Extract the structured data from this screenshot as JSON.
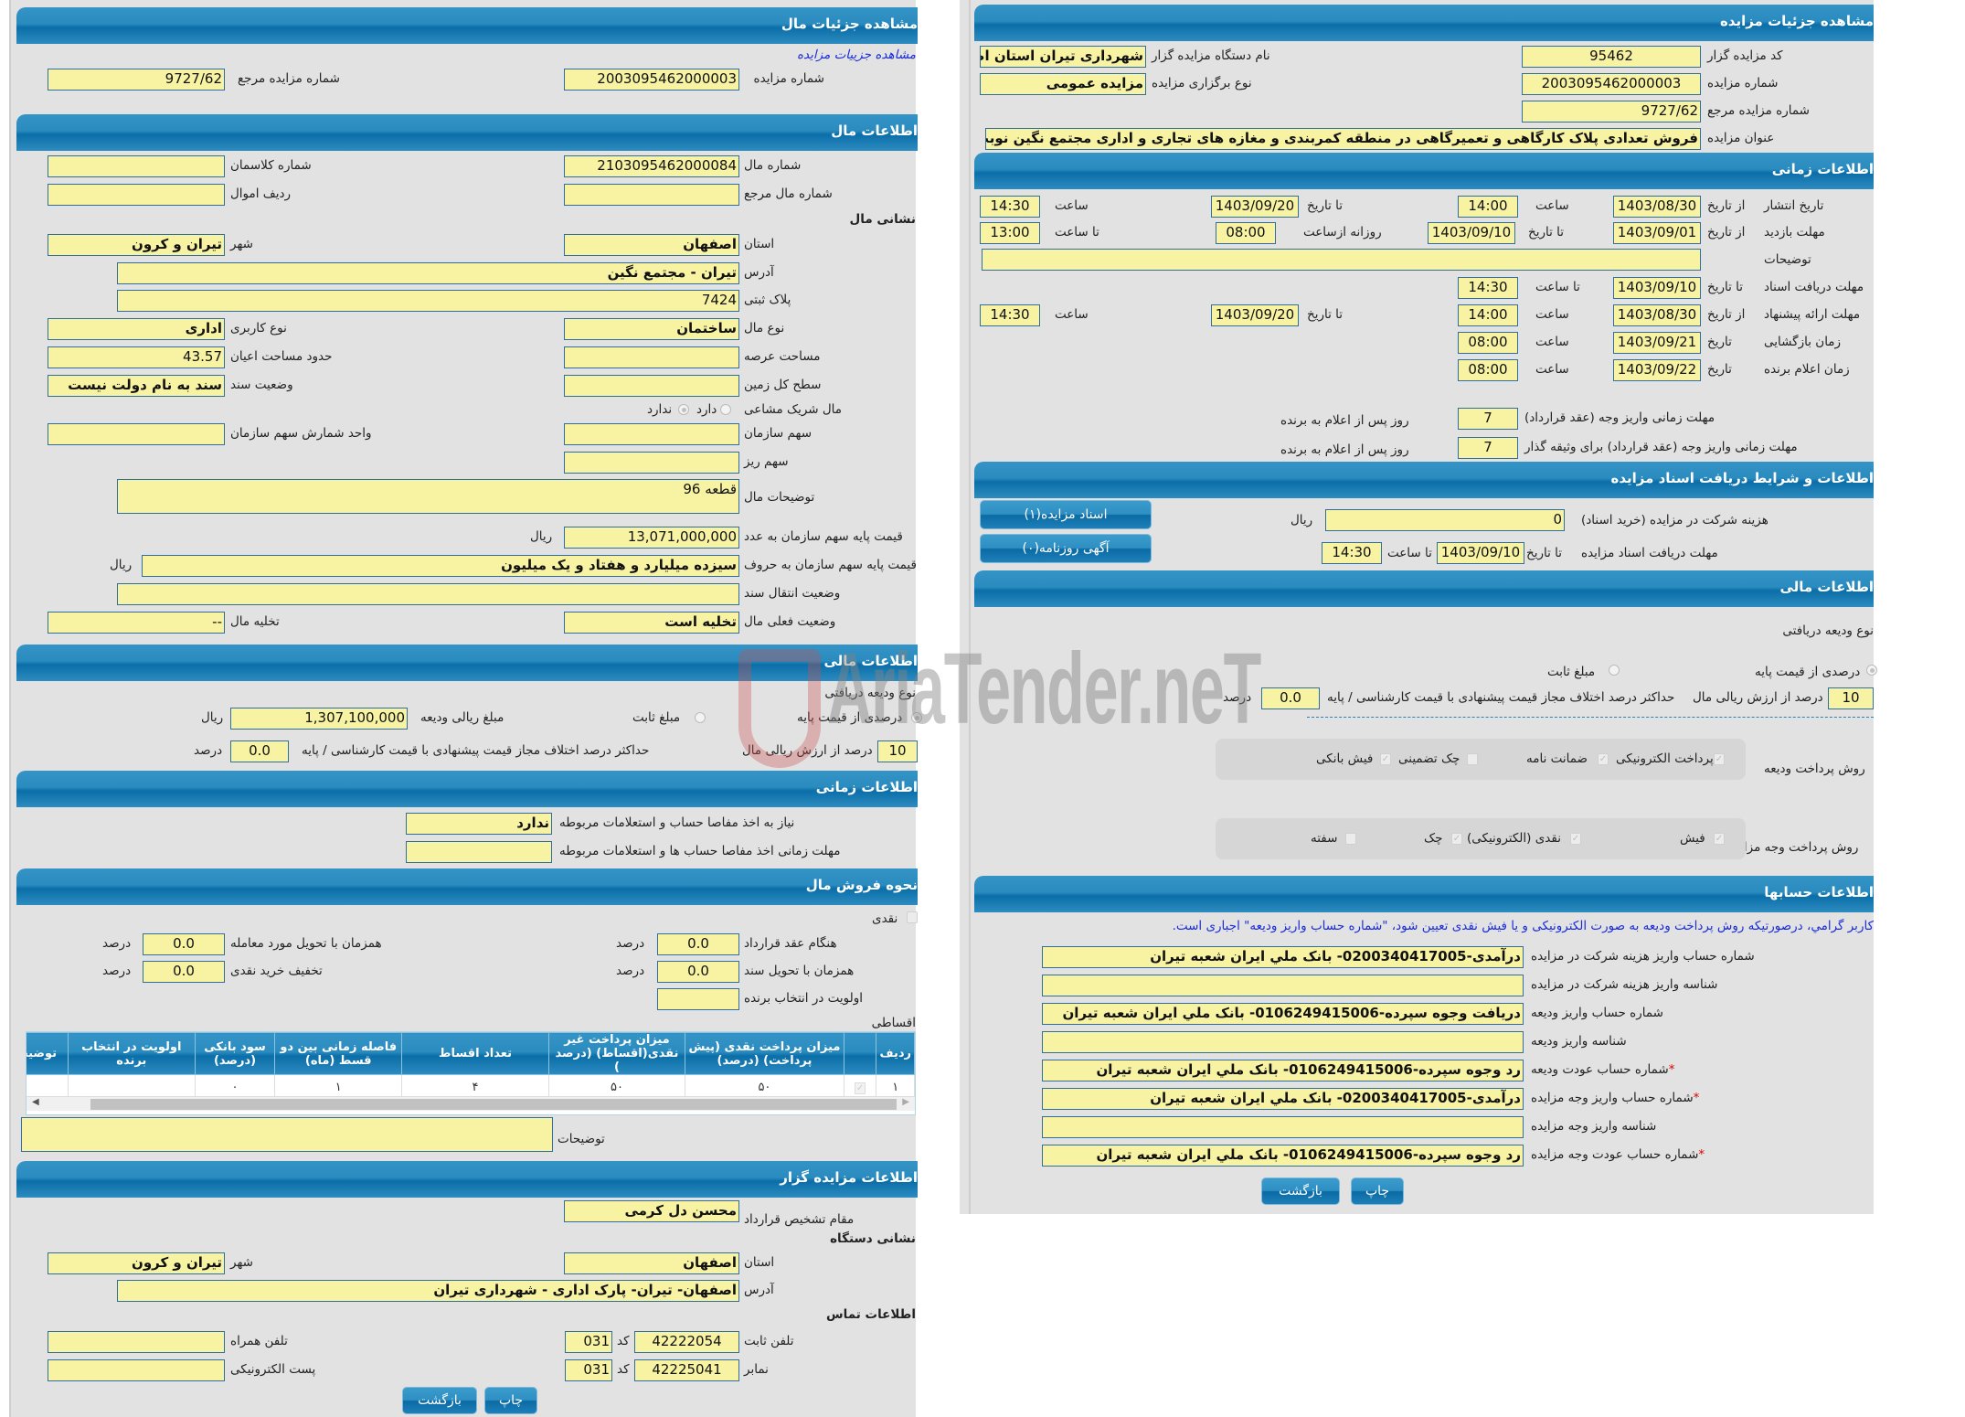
{
  "watermark": "AriaTender.neT",
  "left": {
    "header_title": "مشاهده جزئیات مال",
    "link_auction_details": "مشاهده جزییات مزایده",
    "auction_number_label": "شماره مزایده",
    "auction_number": "2003095462000003",
    "ref_auction_number_label": "شماره مزایده مرجع",
    "ref_auction_number": "9727/62",
    "property_info": {
      "title": "اطلاعات مال",
      "property_number_label": "شماره مال",
      "property_number": "2103095462000084",
      "classman_label": "شماره کلاسمان",
      "classman": "",
      "ref_property_label": "شماره مال مرجع",
      "ref_property": "",
      "asset_row_label": "ردیف اموال",
      "asset_row": "",
      "address_heading": "نشانی مال",
      "province_label": "استان",
      "province": "اصفهان",
      "city_label": "شهر",
      "city": "تیران و کرون",
      "address_label": "آدرس",
      "address": "تیران - مجتمع نگین",
      "plate_label": "پلاک ثبتی",
      "plate": "7424",
      "property_type_label": "نوع مال",
      "property_type": "ساختمان",
      "usage_type_label": "نوع کاربری",
      "usage_type": "اداری",
      "land_area_label": "مساحت عرصه",
      "land_area": "",
      "building_area_label": "حدود مساحت اعیان",
      "building_area": "43.57",
      "total_land_label": "سطح کل زمین",
      "total_land": "",
      "deed_status_label": "وضعیت سند",
      "deed_status": "سند به نام دولت نیست",
      "shared_label": "مال شریک مشاعی",
      "shared_yes": "دارد",
      "shared_no": "ندارد",
      "shared_selected": "ندارد",
      "org_share_label": "سهم سازمان",
      "org_share": "",
      "share_unit_label": "واحد شمارش سهم سازمان",
      "share_unit": "",
      "sub_share_label": "سهم ریز",
      "sub_share": "",
      "description_label": "توضیحات مال",
      "description": "قطعه 96",
      "base_price_num_label": "قیمت پایه سهم سازمان به عدد",
      "base_price_num": "13,071,000,000",
      "base_price_words_label": "قیمت پایه سهم سازمان به حروف",
      "base_price_words": "سیزده میلیارد و هفتاد و یک میلیون",
      "rial": "ریال",
      "deed_transfer_label": "وضعیت انتقال سند",
      "deed_transfer": "",
      "current_status_label": "وضعیت فعلی مال",
      "current_status": "تخلیه است",
      "evacuation_label": "تخلیه مال",
      "evacuation": "--"
    },
    "financial": {
      "title": "اطلاعات مالی",
      "deposit_type_label": "نوع ودیعه دریافتی",
      "percent_of_base": "درصدی از قیمت پایه",
      "fixed_amount": "مبلغ ثابت",
      "selected": "درصدی از قیمت پایه",
      "deposit_rial_label": "مبلغ ریالی ودیعه",
      "deposit_rial": "1,307,100,000",
      "rial": "ریال",
      "percent_value": "10",
      "percent_value_label": "درصد از ارزش ریالی مال",
      "max_diff_label": "حداکثر درصد اختلاف مجاز قیمت پیشنهادی با قیمت کارشناسی / پایه",
      "max_diff": "0.0",
      "percent_unit": "درصد"
    },
    "timing": {
      "title": "اطلاعات زمانی",
      "need_clearance_label": "نیاز به اخذ مفاصا حساب و استعلامات مربوطه",
      "need_clearance": "ندارد",
      "clearance_deadline_label": "مهلت زمانی اخذ مفاصا حساب ها و استعلامات مربوطه",
      "clearance_deadline": ""
    },
    "sale_method": {
      "title": "نحوه فروش مال",
      "cash_label": "نقدی",
      "on_contract_label": "هنگام عقد قرارداد",
      "on_contract": "0.0",
      "on_delivery_label": "همزمان با تحویل مورد معامله",
      "on_delivery": "0.0",
      "on_deed_label": "همزمان با تحویل سند",
      "on_deed": "0.0",
      "cash_discount_label": "تخفیف خرید نقدی",
      "cash_discount": "0.0",
      "priority_label": "اولویت در انتخاب برنده",
      "priority": "",
      "percent_unit": "درصد",
      "installment_label": "اقساطی",
      "table": {
        "headers": [
          "ردیف",
          "",
          "میزان پرداخت نقدی (پیش پرداخت) (درصد)",
          "میزان پرداخت غیر نقدی(اقساط) (درصد )",
          "تعداد اقساط",
          "فاصله زمانی بین دو قسط (ماه)",
          "سود بانکی (درصد)",
          "اولویت در انتخاب برنده",
          "توضیحات"
        ],
        "rows": [
          [
            "۱",
            "✓",
            "۵۰",
            "۵۰",
            "۴",
            "۱",
            "۰",
            "",
            ""
          ]
        ]
      },
      "notes_label": "توضیحات",
      "notes": ""
    },
    "auctioneer": {
      "title": "اطلاعات مزایده گزار",
      "authority_label": "مقام تشخیص قرارداد",
      "authority": "محسن دل کرمی",
      "org_address_heading": "نشانی دستگاه",
      "province_label": "استان",
      "province": "اصفهان",
      "city_label": "شهر",
      "city": "تیران و کرون",
      "address_label": "آدرس",
      "address": "اصفهان- تیران- پارک اداری - شهرداری تیران",
      "contact_heading": "اطلاعات تماس",
      "phone_label": "تلفن ثابت",
      "phone": "42222054",
      "code_label": "کد",
      "phone_code": "031",
      "mobile_label": "تلفن همراه",
      "mobile": "",
      "fax_label": "نمابر",
      "fax": "42225041",
      "fax_code": "031",
      "email_label": "پست الکترونیکی",
      "email": ""
    },
    "buttons": {
      "print": "چاپ",
      "back": "بازگشت"
    }
  },
  "right": {
    "header_title": "مشاهده جزئیات مزایده",
    "auctioneer_code_label": "کد مزایده گزار",
    "auctioneer_code": "95462",
    "org_name_label": "نام دستگاه مزایده گزار",
    "org_name": "شهرداری تیران استان اصفهان",
    "auction_number_label": "شماره مزایده",
    "auction_number": "2003095462000003",
    "holding_type_label": "نوع برگزاری مزایده",
    "holding_type": "مزایده عمومی",
    "ref_number_label": "شماره مزایده مرجع",
    "ref_number": "9727/62",
    "title_label": "عنوان مزایده",
    "title": "فروش تعدادی پلاک کارگاهی و تعمیرگاهی در منطقه کمربندی و مغازه های تجاری و اداری مجتمع نگین نوبت سوم",
    "timing": {
      "title": "اطلاعات زمانی",
      "publish_label": "تاریخ انتشار",
      "from_date_label": "از تاریخ",
      "to_date_label": "تا تاریخ",
      "date_label": "تاریخ",
      "time_label": "ساعت",
      "to_time_label": "تا ساعت",
      "daily_from_label": "روزانه ازساعت",
      "publish_from": "1403/08/30",
      "publish_from_time": "14:00",
      "publish_to": "1403/09/20",
      "publish_to_time": "14:30",
      "visit_label": "مهلت بازدید",
      "visit_from": "1403/09/01",
      "visit_to": "1403/09/10",
      "visit_daily_from": "08:00",
      "visit_to_time": "13:00",
      "description_label": "توضیحات",
      "description": "",
      "doc_deadline_label": "مهلت دریافت اسناد",
      "doc_deadline_date": "1403/09/10",
      "doc_deadline_time": "14:30",
      "offer_label": "مهلت ارائه پیشنهاد",
      "offer_from": "1403/08/30",
      "offer_from_time": "14:00",
      "offer_to": "1403/09/20",
      "offer_to_time": "14:30",
      "opening_label": "زمان بازگشایی",
      "opening_date": "1403/09/21",
      "opening_time": "08:00",
      "winner_label": "زمان اعلام برنده",
      "winner_date": "1403/09/22",
      "winner_time": "08:00",
      "payment_deadline_label": "مهلت زمانی واریز وجه (عقد قرارداد)",
      "payment_deadline": "7",
      "days_after_label": "روز پس از اعلام به برنده",
      "pledge_deadline_label": "مهلت زمانی واریز وجه (عقد قرارداد) برای وثیقه گذار",
      "pledge_deadline": "7"
    },
    "docs": {
      "title": "اطلاعات و شرایط دریافت اسناد مزایده",
      "fee_label": "هزینه شرکت در مزایده (خرید اسناد)",
      "fee": "0",
      "rial": "ریال",
      "deadline_label": "مهلت دریافت اسناد مزایده",
      "to_date_label": "تا تاریخ",
      "to_time_label": "تا ساعت",
      "deadline_date": "1403/09/10",
      "deadline_time": "14:30",
      "docs_button": "اسناد مزایده(۱)",
      "newspaper_button": "آگهی روزنامه(۰)"
    },
    "financial": {
      "title": "اطلاعات مالی",
      "deposit_type_label": "نوع ودیعه دریافتی",
      "percent_of_base": "درصدی از قیمت پایه",
      "fixed_amount": "مبلغ ثابت",
      "selected": "درصدی از قیمت پایه",
      "percent_value": "10",
      "percent_value_label": "درصد از ارزش ریالی مال",
      "max_diff_label": "حداکثر درصد اختلاف مجاز قیمت پیشنهادی با قیمت کارشناسی / پایه",
      "max_diff": "0.0",
      "percent_unit": "درصد",
      "deposit_method_label": "روش پرداخت ودیعه",
      "deposit_methods": [
        {
          "label": "پرداخت الکترونیکی",
          "checked": true
        },
        {
          "label": "ضمانت نامه",
          "checked": true
        },
        {
          "label": "چک تضمینی",
          "checked": false
        },
        {
          "label": "فیش بانکی",
          "checked": true
        }
      ],
      "payment_method_label": "روش پرداخت وجه مزایده",
      "payment_methods": [
        {
          "label": "فیش",
          "checked": true
        },
        {
          "label": "نقدی (الکترونیکی)",
          "checked": true
        },
        {
          "label": "چک",
          "checked": true
        },
        {
          "label": "سفته",
          "checked": false
        }
      ]
    },
    "accounts": {
      "title": "اطلاعات حسابها",
      "notice": "کاربر گرامي، درصورتیکه روش پرداخت ودیعه به صورت الکترونیکی و یا فیش نقدی تعیین شود، \"شماره حساب واریز ودیعه\" اجباری است.",
      "rows": [
        {
          "label": "شماره حساب واریز هزینه شرکت در مزایده",
          "value": "درآمدی-0200340417005- بانک ملي ايران شعبه تيران",
          "required": false
        },
        {
          "label": "شناسه واریز هزینه شرکت در مزایده",
          "value": "",
          "required": false
        },
        {
          "label": "شماره حساب واریز ودیعه",
          "value": "دریافت وجوه سپرده-0106249415006- بانک ملي ايران شعبه تيران",
          "required": false
        },
        {
          "label": "شناسه واریز ودیعه",
          "value": "",
          "required": false
        },
        {
          "label": "شماره حساب عودت ودیعه",
          "value": "رد وجوه سپرده-0106249415006- بانک ملي ايران شعبه تيران",
          "required": true
        },
        {
          "label": "شماره حساب واریز وجه مزایده",
          "value": "درآمدی-0200340417005- بانک ملي ايران شعبه تيران",
          "required": true
        },
        {
          "label": "شناسه واریز وجه مزایده",
          "value": "",
          "required": false
        },
        {
          "label": "شماره حساب عودت وجه مزایده",
          "value": "رد وجوه سپرده-0106249415006- بانک ملي ايران شعبه تيران",
          "required": true
        }
      ]
    },
    "buttons": {
      "print": "چاپ",
      "back": "بازگشت"
    }
  }
}
